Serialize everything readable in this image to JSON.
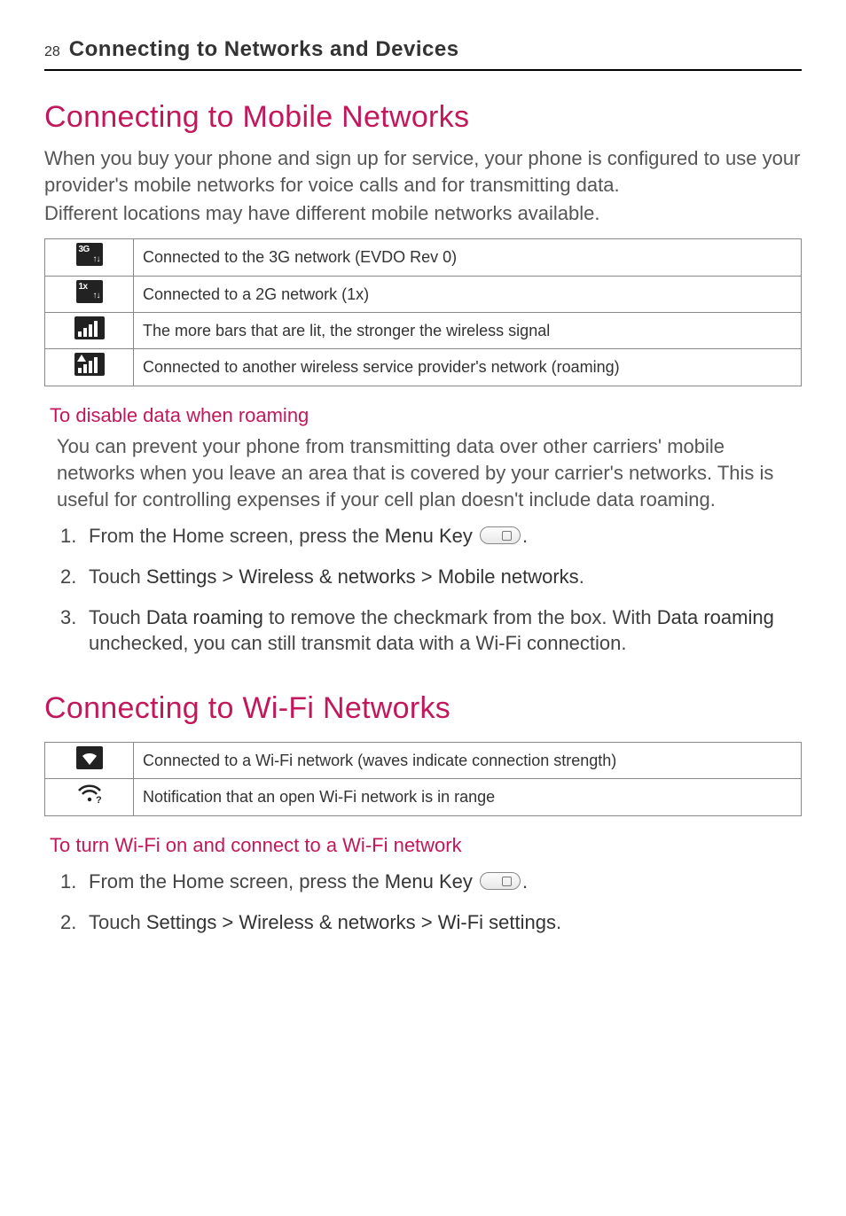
{
  "header": {
    "page_number": "28",
    "chapter": "Connecting to Networks and Devices"
  },
  "s1": {
    "title": "Connecting to Mobile Networks",
    "p1": "When you buy your phone and sign up for service, your phone is configured to use your provider's mobile networks for voice calls and for transmitting data.",
    "p2": "Different locations may have different mobile networks available.",
    "rows": [
      "Connected to the 3G network (EVDO Rev 0)",
      "Connected to a 2G network (1x)",
      "The more bars that are lit, the stronger the wireless signal",
      "Connected to another wireless service provider's network (roaming)"
    ],
    "sub1": {
      "title": "To disable data when roaming",
      "p": "You can prevent your phone from transmitting data over other carriers' mobile networks when you leave an area that is covered by your carrier's networks. This is useful for controlling expenses if your cell plan doesn't include data roaming.",
      "step1_a": "From the Home screen, press the ",
      "step1_b": "Menu Key",
      "step1_c": ".",
      "step2_a": "Touch ",
      "step2_b": "Settings > Wireless & networks > Mobile networks",
      "step2_c": ".",
      "step3_a": "Touch ",
      "step3_b": "Data roaming",
      "step3_c": " to remove the checkmark from the box. With ",
      "step3_d": "Data roaming",
      "step3_e": " unchecked, you can still transmit data with a Wi-Fi connection."
    }
  },
  "s2": {
    "title": "Connecting to Wi-Fi Networks",
    "rows": [
      "Connected to a Wi-Fi network (waves indicate connection strength)",
      "Notification that an open Wi-Fi network is in range"
    ],
    "sub1": {
      "title": "To turn Wi-Fi on and connect to a Wi-Fi network",
      "step1_a": "From the Home screen, press the ",
      "step1_b": "Menu Key",
      "step1_c": ".",
      "step2_a": "Touch ",
      "step2_b": "Settings > Wireless & networks > Wi-Fi settings",
      "step2_c": "."
    }
  }
}
